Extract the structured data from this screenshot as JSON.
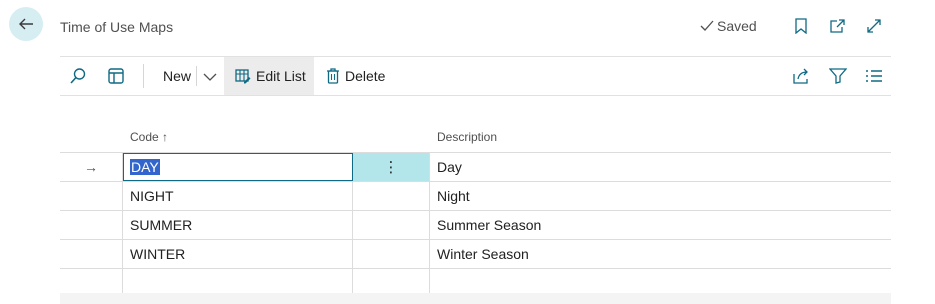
{
  "header": {
    "title": "Time of Use Maps",
    "saved_label": "Saved"
  },
  "toolbar": {
    "new_label": "New",
    "edit_list_label": "Edit List",
    "delete_label": "Delete"
  },
  "table": {
    "columns": {
      "code": "Code",
      "sort_indicator": "↑",
      "description": "Description"
    },
    "rows": [
      {
        "code": "DAY",
        "description": "Day",
        "selected": true
      },
      {
        "code": "NIGHT",
        "description": "Night"
      },
      {
        "code": "SUMMER",
        "description": "Summer Season"
      },
      {
        "code": "WINTER",
        "description": "Winter Season"
      },
      {
        "code": "",
        "description": ""
      }
    ],
    "row_marker": "→",
    "row_menu": "⋮"
  },
  "colors": {
    "accent": "#0f6a84",
    "back_button_bg": "#d6eef2",
    "selected_cell": "#b3e6ea",
    "text_selection": "#3366cc"
  }
}
